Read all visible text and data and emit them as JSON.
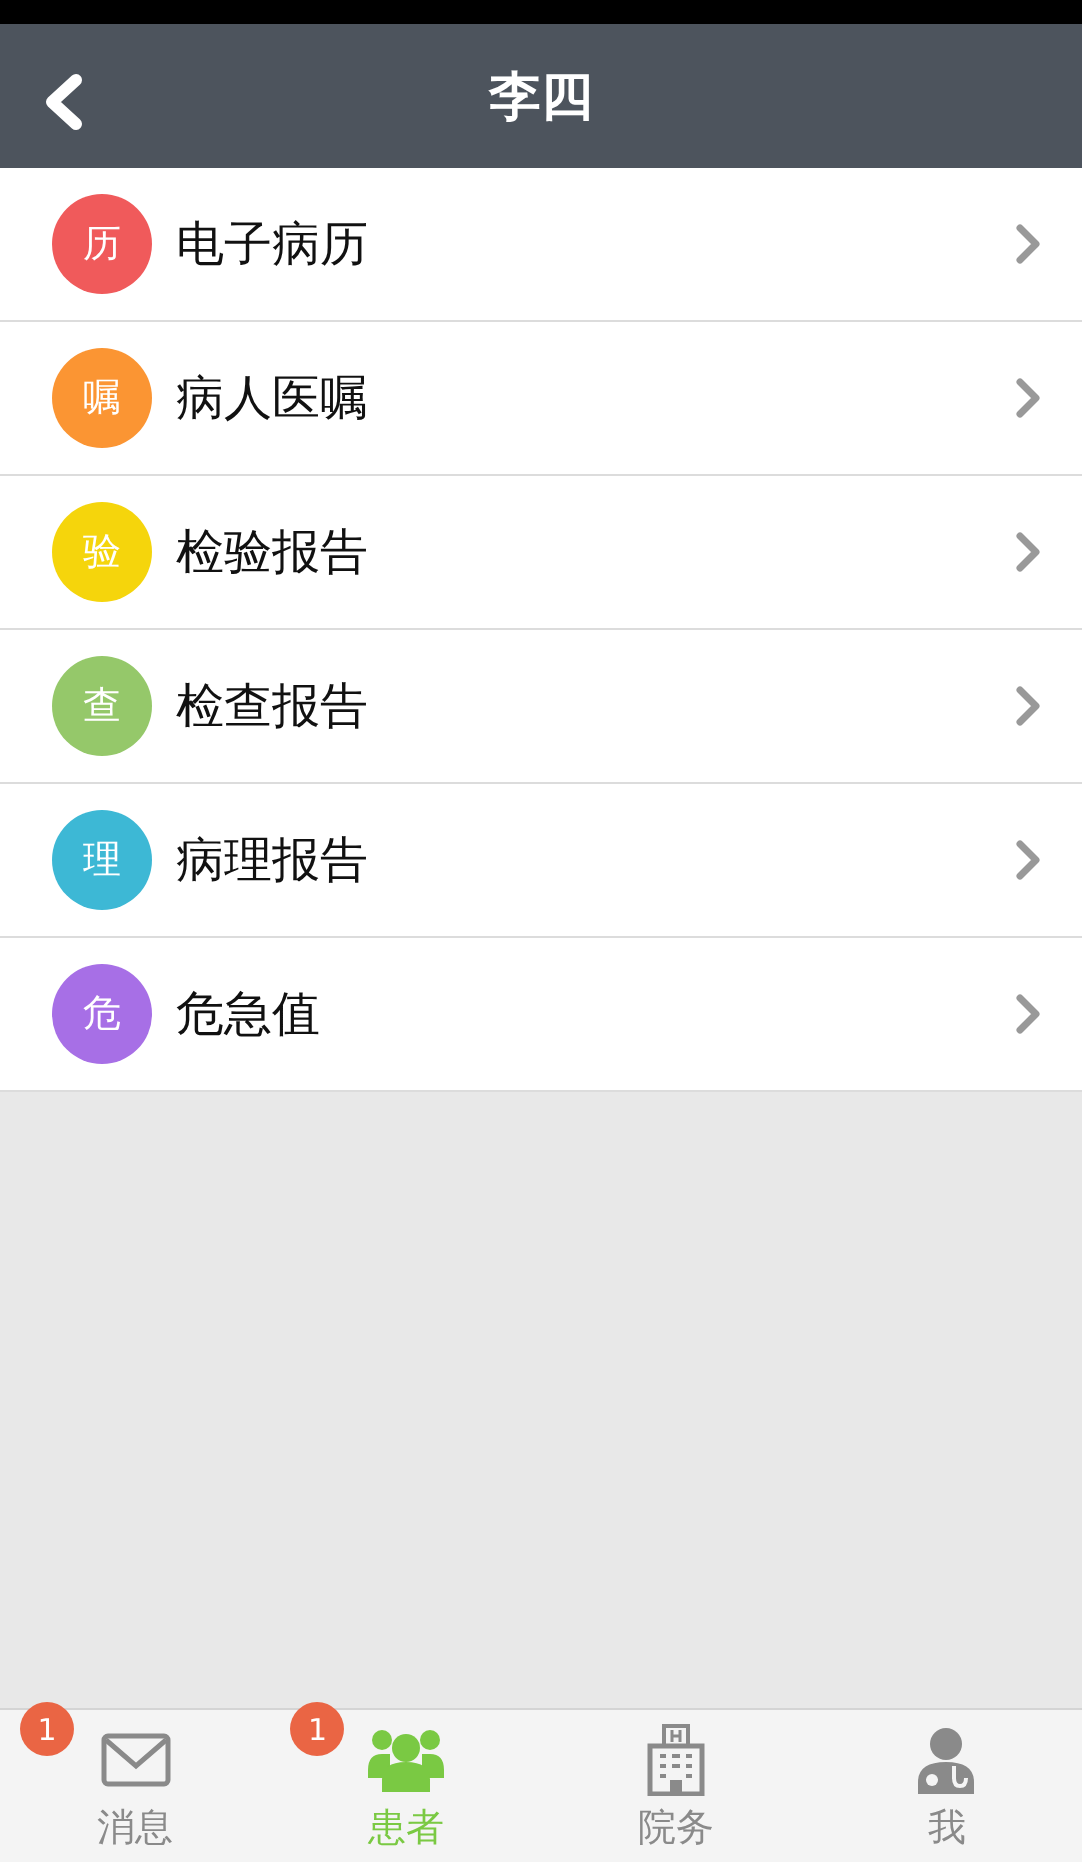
{
  "header": {
    "title": "李四"
  },
  "menu": [
    {
      "badge": "历",
      "label": "电子病历",
      "color": "#f05a5b"
    },
    {
      "badge": "嘱",
      "label": "病人医嘱",
      "color": "#fb9533"
    },
    {
      "badge": "验",
      "label": "检验报告",
      "color": "#f5d50c"
    },
    {
      "badge": "查",
      "label": "检查报告",
      "color": "#95c86a"
    },
    {
      "badge": "理",
      "label": "病理报告",
      "color": "#3db8d5"
    },
    {
      "badge": "危",
      "label": "危急值",
      "color": "#a76fe6"
    }
  ],
  "tab_bar": [
    {
      "kind": "mail",
      "label": "消息",
      "count": "1",
      "selected": false
    },
    {
      "kind": "people",
      "label": "患者",
      "count": "1",
      "selected": true
    },
    {
      "kind": "hospital",
      "label": "院务",
      "selected": false
    },
    {
      "kind": "doctor",
      "label": "我",
      "selected": false
    }
  ]
}
